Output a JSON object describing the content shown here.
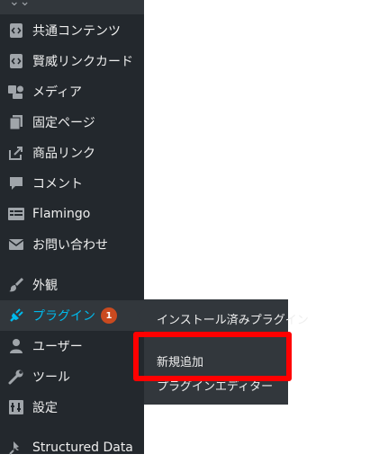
{
  "colors": {
    "sidebar_bg": "#23282d",
    "active_bg": "#32373c",
    "active_text": "#00b9eb",
    "text": "#eeeeee",
    "icon": "#a0a5aa",
    "badge": "#ca4a1f",
    "highlight": "#ff0000"
  },
  "sidebar": {
    "items": [
      {
        "label": "共通コンテンツ",
        "icon": "code-page-icon"
      },
      {
        "label": "賢威リンクカード",
        "icon": "code-page-icon"
      },
      {
        "label": "メディア",
        "icon": "media-icon"
      },
      {
        "label": "固定ページ",
        "icon": "pages-icon"
      },
      {
        "label": "商品リンク",
        "icon": "external-link-icon"
      },
      {
        "label": "コメント",
        "icon": "comment-icon"
      },
      {
        "label": "Flamingo",
        "icon": "list-icon"
      },
      {
        "label": "お問い合わせ",
        "icon": "mail-icon"
      },
      {
        "label": "外観",
        "icon": "brush-icon"
      },
      {
        "label": "プラグイン",
        "icon": "plugin-icon",
        "badge": "1"
      },
      {
        "label": "ユーザー",
        "icon": "user-icon"
      },
      {
        "label": "ツール",
        "icon": "wrench-icon"
      },
      {
        "label": "設定",
        "icon": "settings-icon"
      },
      {
        "label": "Structured Data",
        "icon": "pin-icon"
      }
    ]
  },
  "submenu": {
    "items": [
      {
        "label": "インストール済みプラグイン"
      },
      {
        "label": "新規追加"
      },
      {
        "label": "プラグインエディター"
      }
    ]
  }
}
